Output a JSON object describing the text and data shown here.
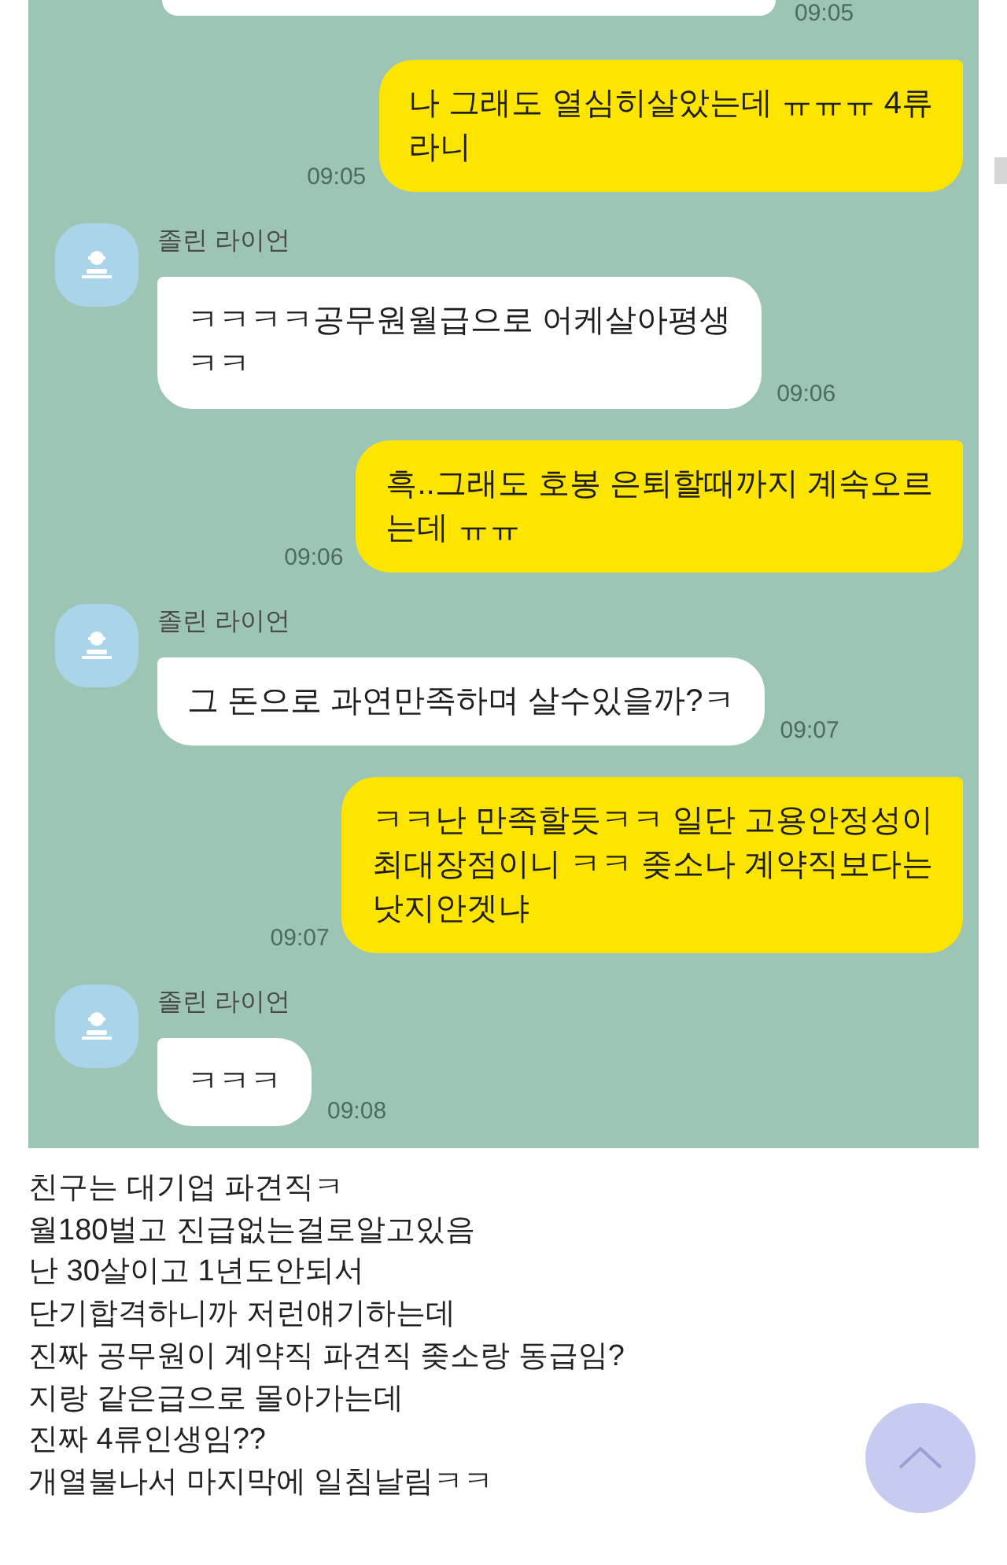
{
  "chat": {
    "messages": [
      {
        "kind": "cut_off",
        "time": "09:05"
      },
      {
        "kind": "sent",
        "lines": [
          "나 그래도 열심히살았는데 ㅠㅠㅠ 4류",
          "라니"
        ],
        "time": "09:05"
      },
      {
        "kind": "received",
        "sender": "졸린 라이언",
        "lines": [
          "ㅋㅋㅋㅋ공무원월급으로 어케살아평생",
          "ㅋㅋ"
        ],
        "time": "09:06"
      },
      {
        "kind": "sent",
        "lines": [
          "흑..그래도 호봉 은퇴할때까지 계속오르",
          "는데 ㅠㅠ"
        ],
        "time": "09:06"
      },
      {
        "kind": "received",
        "sender": "졸린 라이언",
        "lines": [
          "그 돈으로 과연만족하며 살수있을까?ㅋ"
        ],
        "time": "09:07"
      },
      {
        "kind": "sent",
        "lines": [
          "ㅋㅋ난 만족할듯ㅋㅋ 일단 고용안정성이",
          "최대장점이니 ㅋㅋ 좆소나 계약직보다는",
          "낫지안겟냐"
        ],
        "time": "09:07"
      },
      {
        "kind": "received",
        "sender": "졸린 라이언",
        "lines": [
          "ㅋㅋㅋ"
        ],
        "time": "09:08"
      }
    ]
  },
  "post": {
    "lines": [
      "친구는 대기업 파견직ㅋ",
      "월180벌고 진급없는걸로알고있음",
      "난 30살이고 1년도안되서",
      "단기합격하니까 저런얘기하는데",
      "진짜 공무원이 계약직 파견직 좆소랑 동급임?",
      "지랑 같은급으로 몰아가는데",
      "진짜 4류인생임??",
      "개열불나서 마지막에 일침날림ㅋㅋ"
    ]
  }
}
